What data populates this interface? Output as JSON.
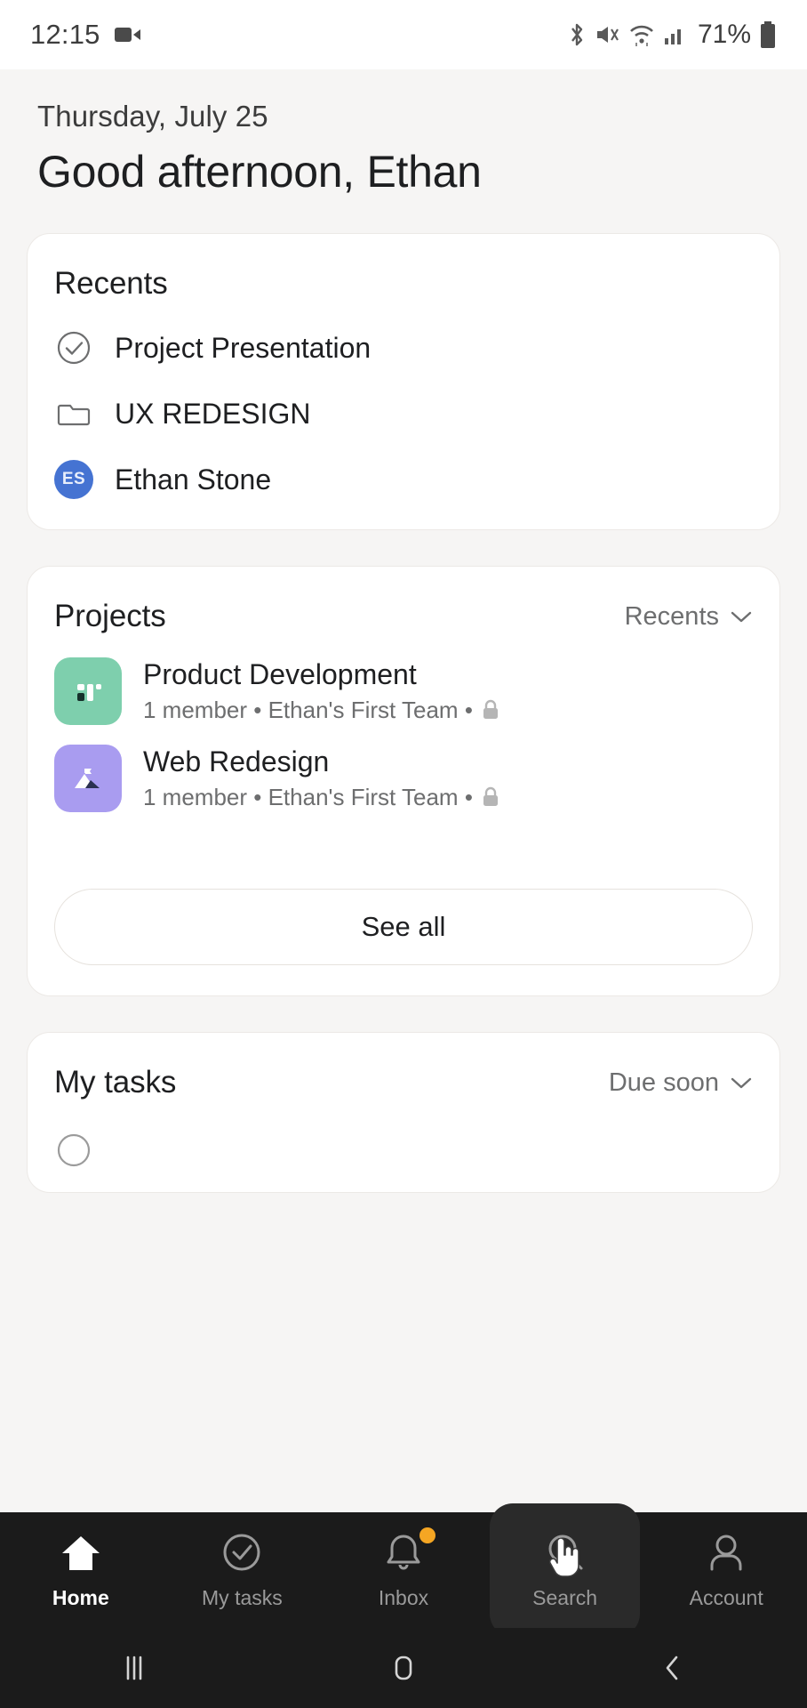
{
  "status_bar": {
    "time": "12:15",
    "battery_percent": "71%",
    "icons": [
      "video-camera-icon",
      "bluetooth-icon",
      "volume-mute-icon",
      "wifi-icon",
      "cell-signal-icon",
      "battery-icon"
    ]
  },
  "greeting": {
    "date": "Thursday, July 25",
    "message": "Good afternoon, Ethan"
  },
  "recents_card": {
    "title": "Recents",
    "items": [
      {
        "label": "Project Presentation",
        "icon": "check-circle-icon"
      },
      {
        "label": "UX REDESIGN",
        "icon": "folder-icon"
      },
      {
        "label": "Ethan Stone",
        "icon": "avatar",
        "initials": "ES"
      }
    ]
  },
  "projects_card": {
    "title": "Projects",
    "filter_label": "Recents",
    "filter_icon": "chevron-down-icon",
    "items": [
      {
        "name": "Product Development",
        "meta": "1 member • Ethan's First Team •",
        "privacy_icon": "lock-icon",
        "icon": "board-icon",
        "color": "#7ECFAD"
      },
      {
        "name": "Web Redesign",
        "meta": "1 member • Ethan's First Team •",
        "privacy_icon": "lock-icon",
        "icon": "milestone-mountain-icon",
        "color": "#A99CF0"
      }
    ],
    "see_all_label": "See all"
  },
  "tasks_card": {
    "title": "My tasks",
    "filter_label": "Due soon",
    "filter_icon": "chevron-down-icon"
  },
  "bottom_nav": {
    "items": [
      {
        "label": "Home",
        "icon": "home-icon",
        "active": true,
        "pressed": false,
        "badge": false
      },
      {
        "label": "My tasks",
        "icon": "check-circle-icon",
        "active": false,
        "pressed": false,
        "badge": false
      },
      {
        "label": "Inbox",
        "icon": "bell-icon",
        "active": false,
        "pressed": false,
        "badge": true
      },
      {
        "label": "Search",
        "icon": "search-icon",
        "active": false,
        "pressed": true,
        "badge": false
      },
      {
        "label": "Account",
        "icon": "person-icon",
        "active": false,
        "pressed": false,
        "badge": false
      }
    ],
    "badge_color": "#F5A623"
  },
  "system_nav": {
    "items": [
      "recents-icon",
      "home-square-icon",
      "back-chevron-icon"
    ]
  },
  "colors": {
    "page_background": "#F6F5F4",
    "card_background": "#FFFFFF",
    "avatar_blue": "#4573D2",
    "nav_background": "#1B1B1B",
    "text_primary": "#1E1F21",
    "text_secondary": "#6D6E6F"
  }
}
